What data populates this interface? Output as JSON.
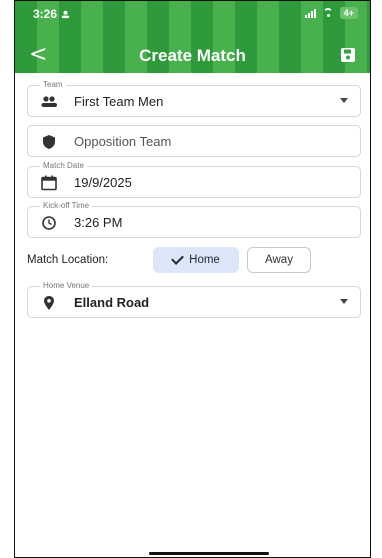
{
  "status_bar": {
    "time": "3:26",
    "battery": "4+"
  },
  "app_bar": {
    "back_label": "<",
    "title": "Create Match"
  },
  "team": {
    "label": "Team",
    "value": "First Team Men"
  },
  "opposition": {
    "placeholder": "Opposition Team"
  },
  "match_date": {
    "label": "Match Date",
    "value": "19/9/2025"
  },
  "kickoff": {
    "label": "Kick-off Time",
    "value": "3:26 PM"
  },
  "location": {
    "label": "Match Location:",
    "home": "Home",
    "away": "Away",
    "selected": "Home"
  },
  "venue": {
    "label": "Home Venue",
    "value": "Elland Road"
  },
  "colors": {
    "header_green": "#3aa245",
    "selected_chip": "#dbe7f8"
  }
}
